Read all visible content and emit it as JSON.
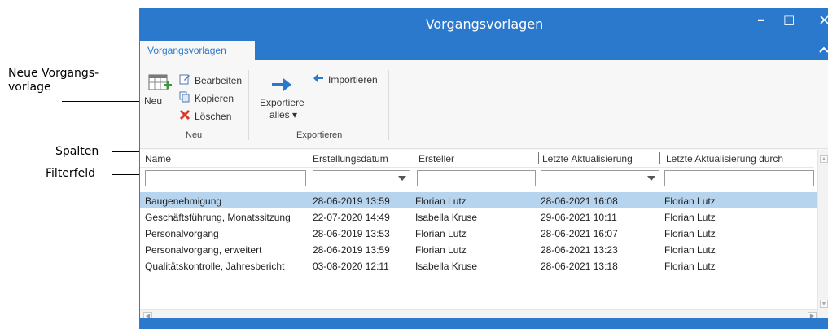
{
  "callouts": {
    "neue_vorlage": "Neue Vorgangs-",
    "neue_vorlage_2": "vorlage",
    "spalten": "Spalten",
    "filterfeld": "Filterfeld"
  },
  "window": {
    "title": "Vorgangsvorlagen",
    "minimize": "–",
    "maximize": "□",
    "close": "×"
  },
  "tab": {
    "label": "Vorgangsvorlagen"
  },
  "ribbon": {
    "neu": "Neu",
    "bearbeiten": "Bearbeiten",
    "kopieren": "Kopieren",
    "loeschen": "Löschen",
    "group_neu": "Neu",
    "importieren": "Importieren",
    "exportiere_1": "Exportiere",
    "exportiere_2": "alles ▾",
    "group_exportieren": "Exportieren"
  },
  "columns": [
    "Name",
    "Erstellungsdatum",
    "Ersteller",
    "Letzte Aktualisierung",
    "Letzte Aktualisierung durch"
  ],
  "rows": [
    [
      "Baugenehmigung",
      "28-06-2019 13:59",
      "Florian Lutz",
      "28-06-2021 16:08",
      "Florian Lutz"
    ],
    [
      "Geschäftsführung, Monatssitzung",
      "22-07-2020 14:49",
      "Isabella Kruse",
      "29-06-2021 10:11",
      "Florian Lutz"
    ],
    [
      "Personalvorgang",
      "28-06-2019 13:53",
      "Florian Lutz",
      "28-06-2021 16:07",
      "Florian Lutz"
    ],
    [
      "Personalvorgang, erweitert",
      "28-06-2019 13:59",
      "Florian Lutz",
      "28-06-2021 13:23",
      "Florian Lutz"
    ],
    [
      "Qualitätskontrolle, Jahresbericht",
      "03-08-2020 12:11",
      "Isabella Kruse",
      "28-06-2021 13:18",
      "Florian Lutz"
    ]
  ],
  "colors": {
    "accent": "#2b79cc",
    "selection": "#b7d4ee"
  }
}
